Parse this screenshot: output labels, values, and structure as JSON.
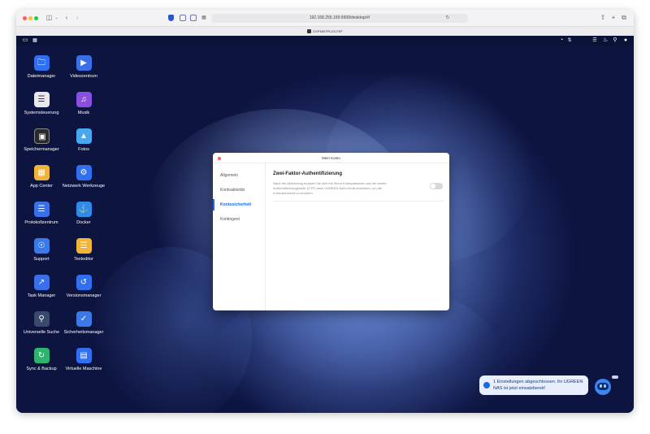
{
  "browser": {
    "url": "192.168.255.169:9999/desktop/#/",
    "tab_title": "DXP480TPLUS-FEF",
    "icons": {
      "sidebar_toggle": "sidebar-icon",
      "back": "chevron-left-icon",
      "forward": "chevron-right-icon",
      "share": "share-icon",
      "new_tab": "plus-icon",
      "tabs": "tabs-overview-icon"
    }
  },
  "desktop": {
    "topbar_icons": [
      "screen-icon",
      "grid-icon",
      "gauge-icon",
      "network-icon",
      "task-icon",
      "bell-icon",
      "search-icon",
      "user-icon"
    ],
    "apps": [
      {
        "name": "Dateimanager",
        "icon": "folder-icon",
        "color": "#2f6ff0"
      },
      {
        "name": "Videozentrum",
        "icon": "play-icon",
        "color": "#3a6fe8"
      },
      {
        "name": "Systemsteuerung",
        "icon": "sliders-icon",
        "color": "#e8e8ee"
      },
      {
        "name": "Musik",
        "icon": "music-icon",
        "color": "#8a4fe0"
      },
      {
        "name": "Speichermanager",
        "icon": "storage-icon",
        "color": "#2a2a2e"
      },
      {
        "name": "Fotos",
        "icon": "image-icon",
        "color": "#49a6f0"
      },
      {
        "name": "App Center",
        "icon": "app-center-icon",
        "color": "#f0b43a"
      },
      {
        "name": "Netzwerk Werkzeuge",
        "icon": "network-tools-icon",
        "color": "#2f6ff0"
      },
      {
        "name": "Protokollzentrum",
        "icon": "log-icon",
        "color": "#3a6fe8"
      },
      {
        "name": "Docker",
        "icon": "docker-icon",
        "color": "#2f8ae8"
      },
      {
        "name": "Support",
        "icon": "bulb-icon",
        "color": "#3a7ae8"
      },
      {
        "name": "Texteditor",
        "icon": "text-editor-icon",
        "color": "#f0b43a"
      },
      {
        "name": "Task Manager",
        "icon": "chart-icon",
        "color": "#3a6fe8"
      },
      {
        "name": "Versionsmanager",
        "icon": "history-icon",
        "color": "#2f6ff0"
      },
      {
        "name": "Universelle Suche",
        "icon": "search-icon",
        "color": "#3a4a6e"
      },
      {
        "name": "Sicherheitsmanager",
        "icon": "shield-icon",
        "color": "#3a7ae8"
      },
      {
        "name": "Sync & Backup",
        "icon": "sync-icon",
        "color": "#2fb46e"
      },
      {
        "name": "Virtuelle Maschine",
        "icon": "vm-icon",
        "color": "#2f6ff0"
      }
    ]
  },
  "dialog": {
    "title": "Mein Konto",
    "sidebar": [
      {
        "label": "Allgemein"
      },
      {
        "label": "Kontoaktivität"
      },
      {
        "label": "Kontosicherheit"
      },
      {
        "label": "Kontingent"
      }
    ],
    "active_index": 2,
    "section": {
      "title": "Zwei-Faktor-Authentifizierung",
      "description": "Nach der Aktivierung müssen Sie sich mit Ihrem Kontopasswort und der zweite Authentifizierungsstufe (OTP) beim UGREEN NAS-Gerät anmelden, um die Kontosicherheit zu erhöhen.",
      "toggle_on": false
    },
    "accent": "#1a6be0"
  },
  "notification": {
    "text": "1 Einstellungen abgeschlossen. Ihr UGREEN NAS ist jetzt einsatzbereit!"
  }
}
